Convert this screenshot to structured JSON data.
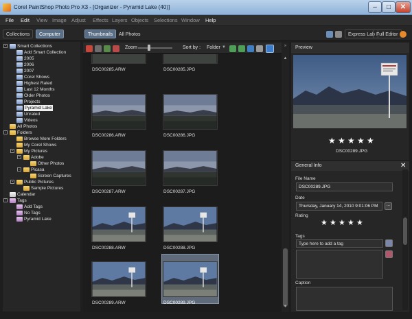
{
  "window": {
    "title": "Corel PaintShop Photo Pro X3 - [Organizer - Pyramid Lake (40)]"
  },
  "menu": [
    "File",
    "Edit",
    "View",
    "Image",
    "Adjust",
    "Effects",
    "Layers",
    "Objects",
    "Selections",
    "Window",
    "Help"
  ],
  "toolbar": {
    "tabs": [
      "Collections",
      "Computer"
    ],
    "views": [
      "Thumbnails",
      "All Photos"
    ],
    "express_lab": "Express Lab",
    "full_editor": "Full Editor",
    "zoom_label": "Zoom",
    "sort_label": "Sort by :",
    "sort_value": "Folder",
    "expand": "»"
  },
  "tree": [
    {
      "label": "Smart Collections",
      "level": 0,
      "exp": "-",
      "icon": "smart"
    },
    {
      "label": "Add Smart Collection",
      "level": 1,
      "icon": "smart"
    },
    {
      "label": "2005",
      "level": 1,
      "icon": "smart"
    },
    {
      "label": "2006",
      "level": 1,
      "icon": "smart"
    },
    {
      "label": "2007",
      "level": 1,
      "icon": "smart"
    },
    {
      "label": "Corel Shows",
      "level": 1,
      "icon": "smart"
    },
    {
      "label": "Highest Rated",
      "level": 1,
      "icon": "smart"
    },
    {
      "label": "Last 12 Months",
      "level": 1,
      "icon": "smart"
    },
    {
      "label": "Older Photos",
      "level": 1,
      "icon": "smart"
    },
    {
      "label": "Projects",
      "level": 1,
      "icon": "smart"
    },
    {
      "label": "Pyramid Lake",
      "level": 1,
      "icon": "smart",
      "selected": true
    },
    {
      "label": "Unrated",
      "level": 1,
      "icon": "smart"
    },
    {
      "label": "Videos",
      "level": 1,
      "icon": "smart"
    },
    {
      "label": "All Photos",
      "level": 0,
      "icon": "photos"
    },
    {
      "label": "Folders",
      "level": 0,
      "exp": "-",
      "icon": "folder"
    },
    {
      "label": "Browse More Folders",
      "level": 1,
      "icon": "folder"
    },
    {
      "label": "My Corel Shows",
      "level": 1,
      "icon": "folder"
    },
    {
      "label": "My Pictures",
      "level": 1,
      "exp": "-",
      "icon": "folder"
    },
    {
      "label": "Adobe",
      "level": 2,
      "exp": "-",
      "icon": "folder"
    },
    {
      "label": "Other Photos",
      "level": 3,
      "icon": "folder"
    },
    {
      "label": "Picasa",
      "level": 2,
      "exp": "-",
      "icon": "folder"
    },
    {
      "label": "Screen Captures",
      "level": 3,
      "icon": "folder"
    },
    {
      "label": "Public Pictures",
      "level": 1,
      "exp": "-",
      "icon": "folder"
    },
    {
      "label": "Sample Pictures",
      "level": 2,
      "icon": "folder"
    },
    {
      "label": "Calendar",
      "level": 0,
      "icon": "calendar"
    },
    {
      "label": "Tags",
      "level": 0,
      "exp": "-",
      "icon": "tag"
    },
    {
      "label": "Add Tags",
      "level": 1,
      "icon": "tag"
    },
    {
      "label": "No Tags",
      "level": 1,
      "icon": "tag"
    },
    {
      "label": "Pyramid Lake",
      "level": 1,
      "icon": "tag"
    }
  ],
  "thumbnails": [
    {
      "name": "DSC00285.ARW",
      "scene": "mountains"
    },
    {
      "name": "DSC00285.JPG",
      "scene": "mountains"
    },
    {
      "name": "DSC00286.ARW",
      "scene": "dusk"
    },
    {
      "name": "DSC00286.JPG",
      "scene": "dusk"
    },
    {
      "name": "DSC00287.ARW",
      "scene": "dusk"
    },
    {
      "name": "DSC00287.JPG",
      "scene": "dusk"
    },
    {
      "name": "DSC00288.ARW",
      "scene": "sign"
    },
    {
      "name": "DSC00288.JPG",
      "scene": "sign"
    },
    {
      "name": "DSC00289.ARW",
      "scene": "sign"
    },
    {
      "name": "DSC00289.JPG",
      "scene": "sign",
      "selected": true
    }
  ],
  "preview": {
    "header": "Preview",
    "rating": 5,
    "filename": "DSC00289.JPG"
  },
  "general_info": {
    "header": "General Info",
    "close": "✕",
    "file_name_label": "File Name",
    "file_name": "DSC00289.JPG",
    "date_label": "Date",
    "date": "Thursday, January 14, 2010 9:01:06 PM",
    "date_btn": "...",
    "rating_label": "Rating",
    "rating": 5,
    "tags_label": "Tags",
    "tags_placeholder": "Type here to add a tag",
    "caption_label": "Caption"
  }
}
